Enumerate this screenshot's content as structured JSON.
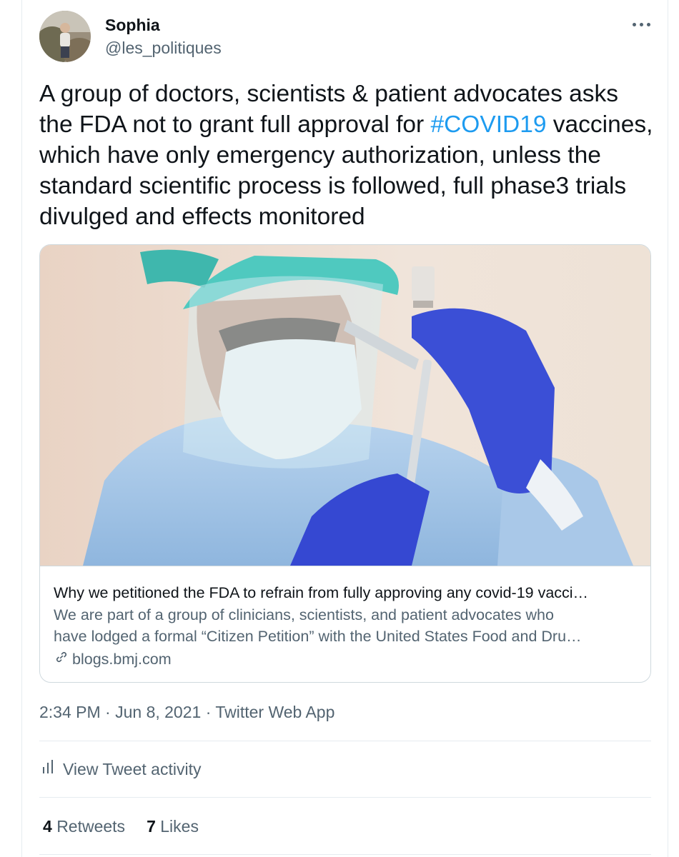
{
  "author": {
    "display_name": "Sophia",
    "handle": "@les_politiques"
  },
  "tweet": {
    "text_before": "A group of doctors, scientists & patient advocates asks the FDA not to grant full approval for ",
    "hashtag": "#COVID19",
    "text_after": " vaccines, which have only emergency authorization, unless the standard scientific process is followed, full phase3 trials divulged and effects monitored"
  },
  "card": {
    "title": "Why we petitioned the FDA to refrain from fully approving any covid-19 vacci…",
    "description_line1": "We are part of a group of clinicians, scientists, and patient advocates who",
    "description_line2": "have lodged a formal “Citizen Petition” with the United States Food and Dru…",
    "domain": "blogs.bmj.com",
    "image_icon": "photo-vaccine-syringe"
  },
  "meta": {
    "timestamp": "2:34 PM · Jun 8, 2021 · Twitter Web App"
  },
  "activity": {
    "label": "View Tweet activity",
    "icon": "bar-chart-icon"
  },
  "stats": {
    "retweets_count": "4",
    "retweets_label": "Retweets",
    "likes_count": "7",
    "likes_label": "Likes"
  },
  "colors": {
    "link": "#1d9bf0",
    "secondary_text": "#536471",
    "border": "#cfd9de"
  }
}
